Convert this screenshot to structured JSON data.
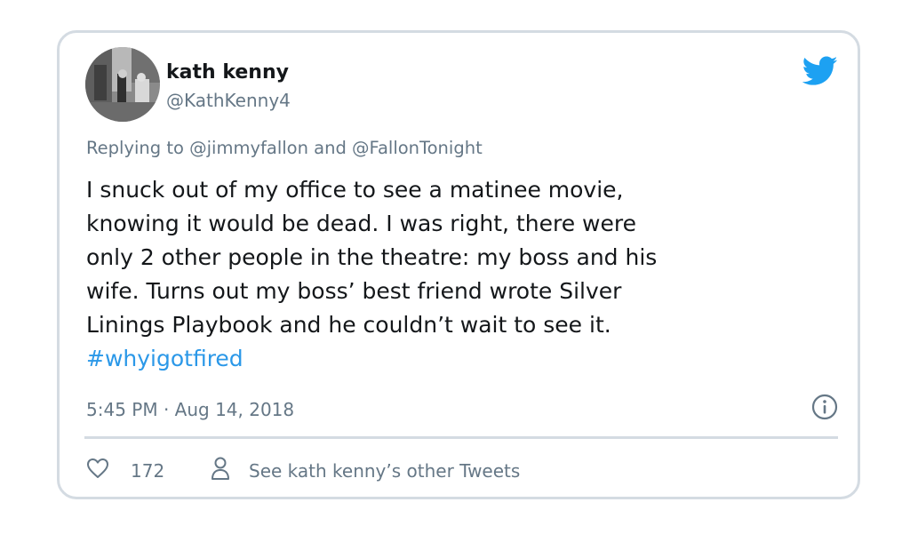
{
  "author": {
    "name": "kath kenny",
    "handle": "@KathKenny4"
  },
  "tweet": {
    "replying_to": "Replying to @jimmyfallon and @FallonTonight",
    "lines": [
      "I snuck out of my office to see a matinee movie,",
      "knowing it would be dead. I was right, there were",
      "only 2 other people in the theatre: my boss and his",
      "wife. Turns out my boss’ best friend wrote Silver",
      "Linings Playbook and he couldn’t wait to see it."
    ],
    "hashtag": "#whyigotfired",
    "timestamp": "5:45 PM · Aug 14, 2018"
  },
  "actions": {
    "like_count": "172",
    "other_tweets_label": "See kath kenny’s other Tweets"
  },
  "icons": {
    "brand": "twitter-bird-icon",
    "info": "info-icon",
    "like": "heart-icon",
    "profile": "person-icon"
  },
  "colors": {
    "brand_blue": "#1da1f2",
    "hashtag": "#2b98e8",
    "muted_text": "#657786",
    "main_text": "#14171a",
    "border": "#d4dbe2"
  }
}
